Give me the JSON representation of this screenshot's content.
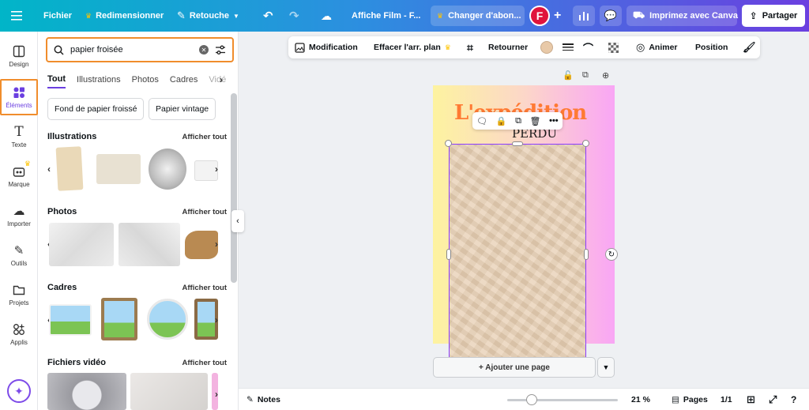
{
  "topbar": {
    "file": "Fichier",
    "resize": "Redimensionner",
    "retouch": "Retouche",
    "doc_title": "Affiche  Film - F...",
    "upgrade": "Changer d'abon...",
    "avatar": "F",
    "print": "Imprimez avec Canva",
    "share": "Partager"
  },
  "rail": [
    {
      "label": "Design",
      "icon": "design-icon"
    },
    {
      "label": "Éléments",
      "icon": "elements-icon"
    },
    {
      "label": "Texte",
      "icon": "text-icon"
    },
    {
      "label": "Marque",
      "icon": "brand-icon"
    },
    {
      "label": "Importer",
      "icon": "upload-icon"
    },
    {
      "label": "Outils",
      "icon": "tools-icon"
    },
    {
      "label": "Projets",
      "icon": "folder-icon"
    },
    {
      "label": "Applis",
      "icon": "apps-icon"
    }
  ],
  "panel": {
    "search_value": "papier froisée",
    "tabs": [
      "Tout",
      "Illustrations",
      "Photos",
      "Cadres",
      "Vidé"
    ],
    "chips": [
      "Fond de papier froissé",
      "Papier vintage"
    ],
    "sections": {
      "illustrations": "Illustrations",
      "photos": "Photos",
      "frames": "Cadres",
      "videos": "Fichiers vidéo"
    },
    "see_all": "Afficher tout"
  },
  "toolbar": {
    "edit": "Modification",
    "bg_remove": "Effacer l'arr. plan",
    "flip": "Retourner",
    "animate": "Animer",
    "position": "Position"
  },
  "canvas": {
    "headline": "L'expédition",
    "subtitle": "PERDU",
    "add_page": "+ Ajouter une page"
  },
  "bottombar": {
    "notes": "Notes",
    "zoom": "21 %",
    "pages": "Pages",
    "page_count": "1/1"
  },
  "colors": {
    "accent": "#8b3dff",
    "highlight": "#f08d2c",
    "avatar": "#e0143c"
  }
}
